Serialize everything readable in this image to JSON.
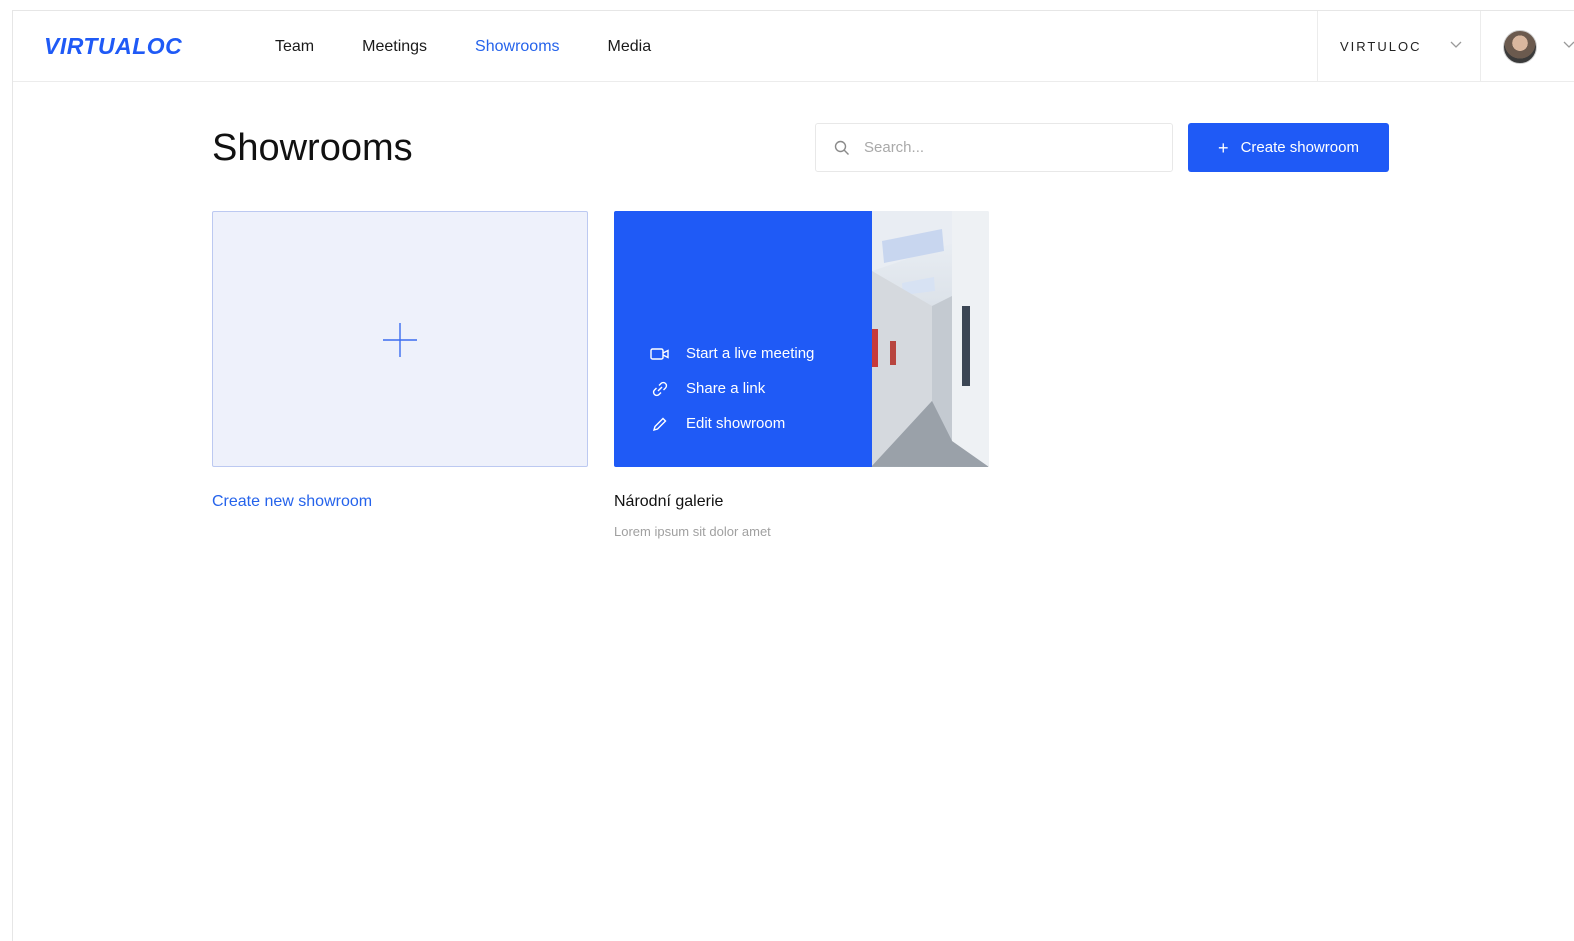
{
  "header": {
    "logo": "VIRTUALOC",
    "nav": [
      {
        "label": "Team",
        "active": false
      },
      {
        "label": "Meetings",
        "active": false
      },
      {
        "label": "Showrooms",
        "active": true
      },
      {
        "label": "Media",
        "active": false
      }
    ],
    "org_name": "VIRTULOC",
    "icons": {
      "org_dropdown": "chevron-down-icon",
      "user_dropdown": "chevron-down-icon",
      "avatar": "user-avatar"
    }
  },
  "page": {
    "title": "Showrooms",
    "search_placeholder": "Search...",
    "create_button": "Create showroom"
  },
  "new_card": {
    "label": "Create new showroom",
    "icon": "plus-icon"
  },
  "showrooms": [
    {
      "name": "Národní galerie",
      "description": "Lorem ipsum sit dolor amet",
      "actions": [
        {
          "label": "Start a live meeting",
          "icon": "video-icon"
        },
        {
          "label": "Share a link",
          "icon": "link-icon"
        },
        {
          "label": "Edit showroom",
          "icon": "pencil-icon"
        }
      ]
    }
  ],
  "colors": {
    "accent": "#1f5af6",
    "link": "#2563eb",
    "new_card_bg": "#eef1fb",
    "muted_text": "#a0a0a0"
  }
}
